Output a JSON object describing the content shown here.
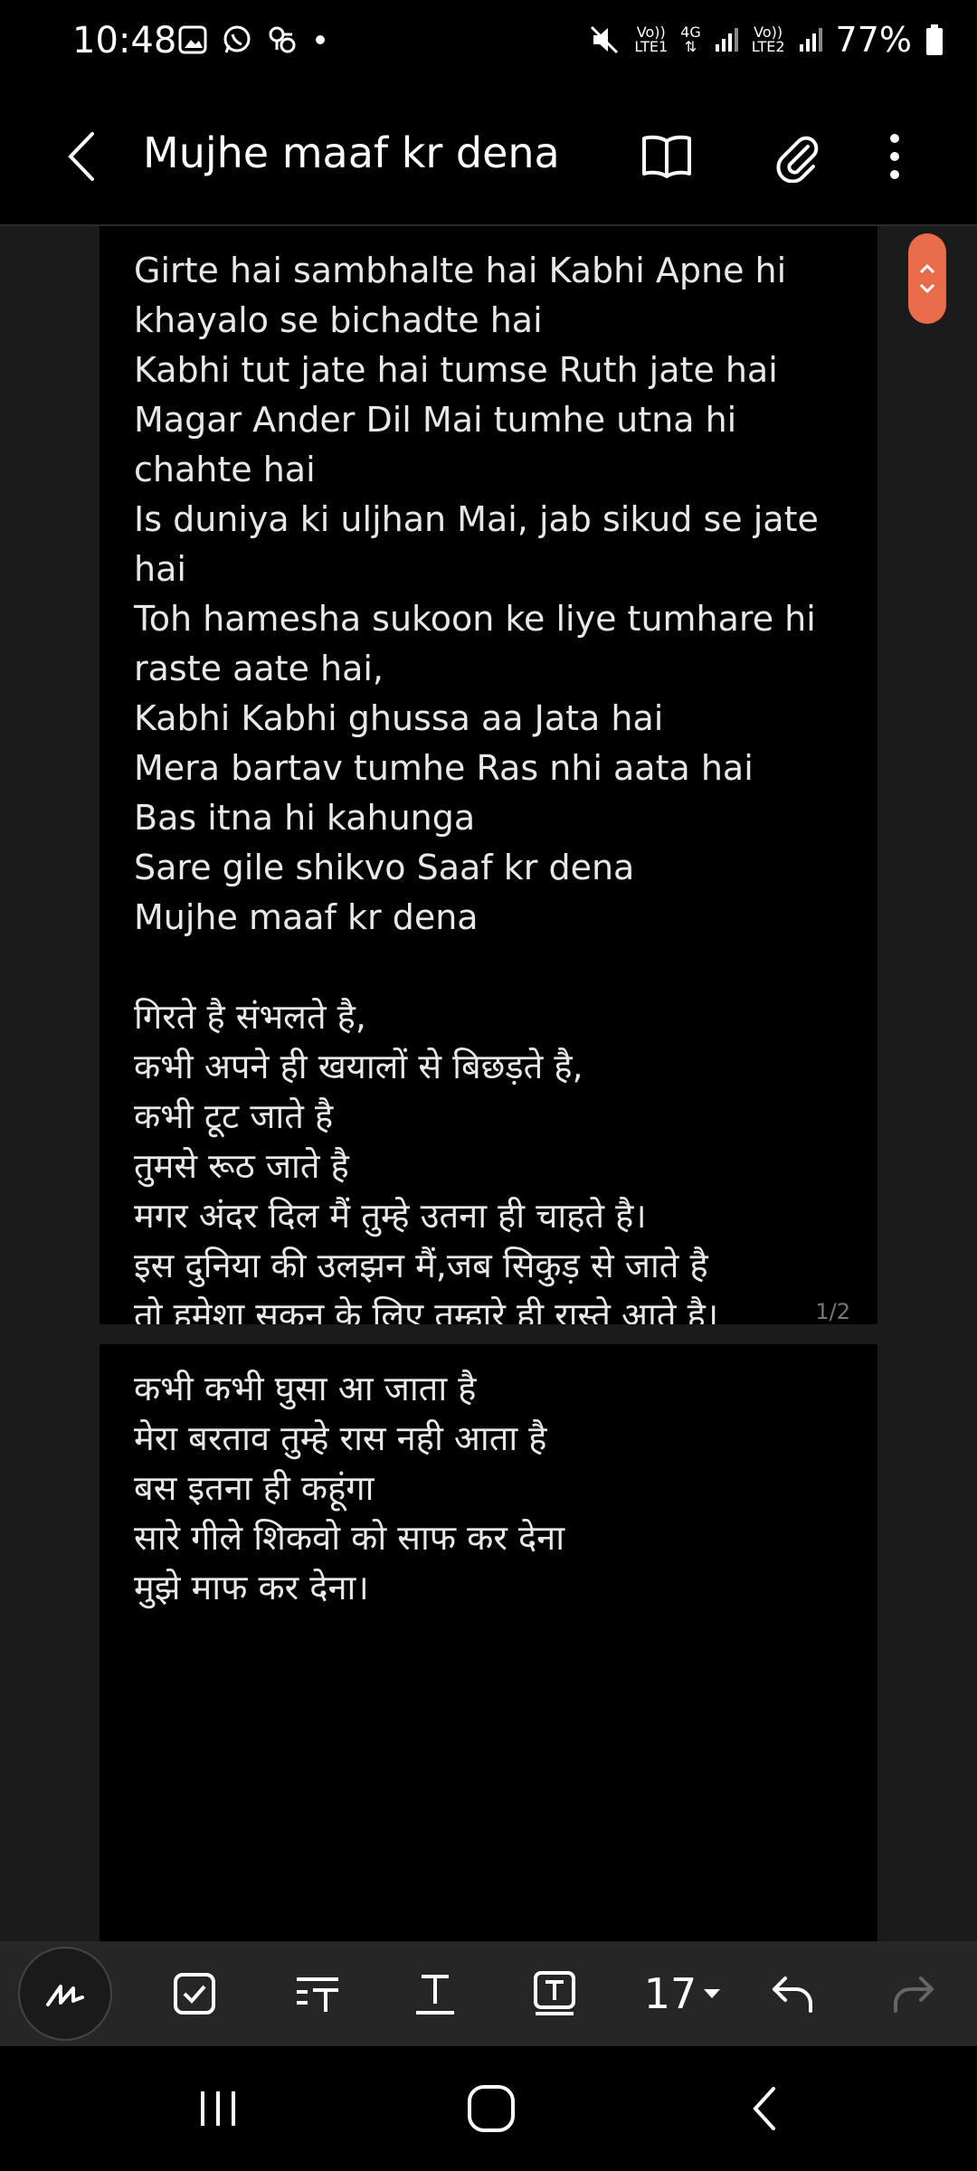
{
  "status_bar": {
    "time": "10:48",
    "net1_top": "Vo))",
    "net1_bottom": "LTE1",
    "net_type": "4G",
    "net2_top": "Vo))",
    "net2_bottom": "LTE2",
    "battery": "77%"
  },
  "app_bar": {
    "title": "Mujhe maaf kr dena"
  },
  "pages": [
    {
      "text": "Girte hai sambhalte hai Kabhi Apne hi khayalo se bichadte hai\nKabhi tut jate hai tumse Ruth jate hai\nMagar Ander Dil Mai tumhe utna hi chahte hai\nIs duniya ki uljhan Mai, jab sikud se jate hai\nToh hamesha sukoon ke liye tumhare hi raste aate hai,\nKabhi Kabhi ghussa aa Jata hai\nMera bartav tumhe Ras nhi aata hai\nBas itna hi kahunga\nSare gile shikvo Saaf kr dena\nMujhe maaf kr dena\n\nगिरते है संभलते है,\nकभी अपने ही खयालों से बिछड़ते है,\nकभी टूट जाते है\nतुमसे रूठ जाते है\nमगर अंदर दिल मैं तुम्हे उतना ही चाहते है।\nइस दुनिया की उलझन मैं,जब सिकुड़ से जाते है\nतो हमेशा सुकून के लिए तुम्हारे ही रास्ते आते है।",
      "page_number": "1/2"
    },
    {
      "text": "कभी कभी घुसा आ जाता है\nमेरा बरताव तुम्हे रास नही आता है\nबस इतना ही कहूंगा\nसारे गीले शिकवो को साफ कर देना\nमुझे माफ कर देना।"
    }
  ],
  "toolbar": {
    "font_size": "17"
  },
  "colors": {
    "accent": "#e86c4a",
    "page_bg": "#000000",
    "canvas_bg": "#1b1b1b",
    "toolbar_bg": "#262626"
  }
}
